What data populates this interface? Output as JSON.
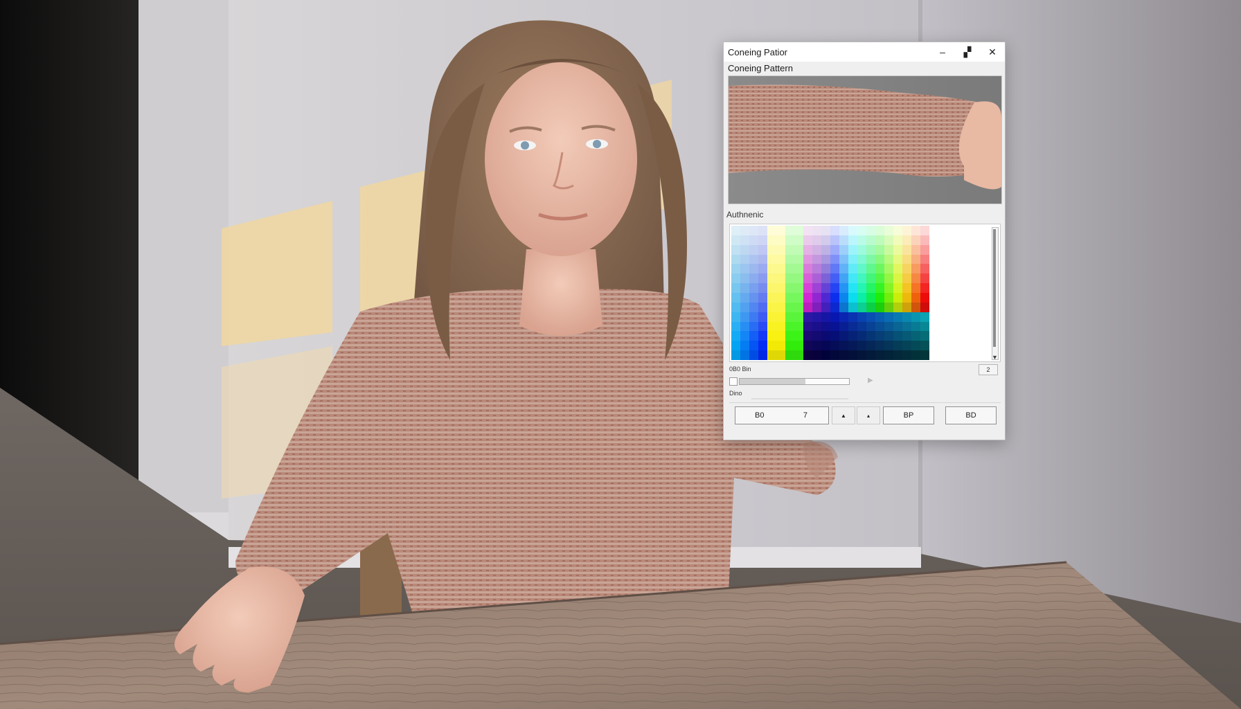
{
  "window": {
    "title": "Coneing Patior",
    "subtitle": "Coneing Pattern",
    "minimize_glyph": "–",
    "restore_glyph": "▞",
    "close_glyph": "✕"
  },
  "color_section": {
    "label": "Authnenic"
  },
  "controls": {
    "row_a_label": "0B0 Bin",
    "corner_button_label": "2",
    "slider_value": 0.6,
    "row_b_label": "Dino"
  },
  "buttons": {
    "field_left": "B0",
    "field_right": "7",
    "step_up": "▲",
    "step_down": "▴",
    "ok_label": "BP",
    "cancel_label": "BD"
  },
  "colors": {
    "title_bg": "#ffffff",
    "dialog_bg": "#efefef",
    "sweater": "#b88a7a",
    "wall": "#cfcfd4"
  },
  "icons": {
    "minimize": "minimize-icon",
    "maximize": "maximize-icon",
    "close": "close-icon",
    "play": "play-icon",
    "scroll": "scroll-arrow-icon"
  }
}
